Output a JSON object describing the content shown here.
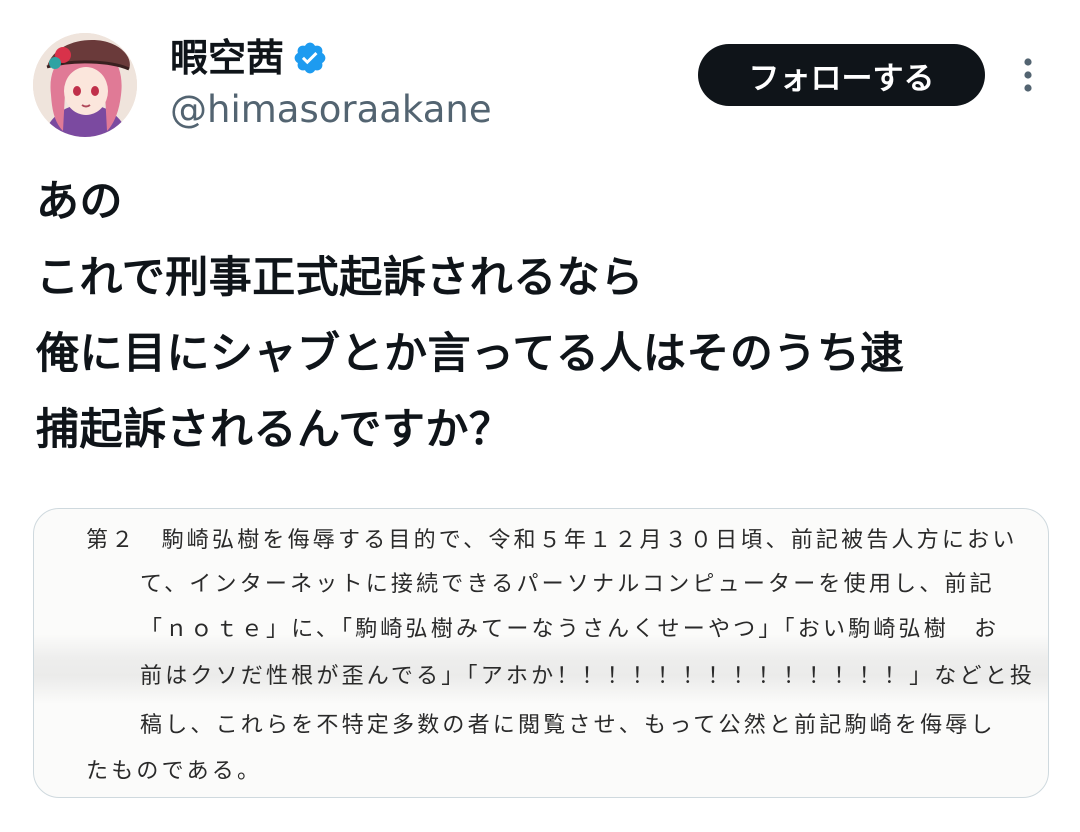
{
  "user": {
    "display_name": "暇空茜",
    "handle": "@himasoraakane",
    "verified": true
  },
  "actions": {
    "follow_label": "フォローする",
    "more_icon": "more-dots-icon"
  },
  "tweet": {
    "lines": [
      "あの",
      "これで刑事正式起訴されるなら",
      "俺に目にシャブとか言ってる人はそのうち逮",
      "捕起訴されるんですか？"
    ]
  },
  "media": {
    "document_lines": [
      "第２　駒崎弘樹を侮辱する目的で、令和５年１２月３０日頃、前記被告人方におい",
      "て、インターネットに接続できるパーソナルコンピューターを使用し、前記",
      "「ｎｏｔｅ」に、「駒崎弘樹みてーなうさんくせーやつ」「おい駒崎弘樹　お",
      "前はクソだ性根が歪んでる」「アホか！！！！！！！！！！！！！！」などと投",
      "稿し、これらを不特定多数の者に閲覧させ、もって公然と前記駒崎を侮辱し",
      "たものである。"
    ]
  },
  "colors": {
    "text_primary": "#0f1419",
    "text_secondary": "#536471",
    "button_bg": "#0f1419",
    "verified_blue": "#1d9bf0",
    "border": "#cfd9de"
  }
}
